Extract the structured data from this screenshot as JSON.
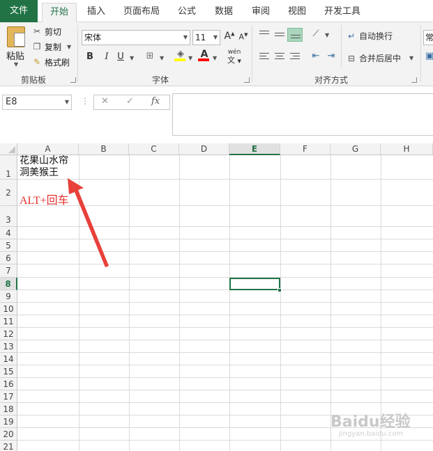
{
  "ribbon_tabs": [
    {
      "label": "文件"
    },
    {
      "label": "开始"
    },
    {
      "label": "插入"
    },
    {
      "label": "页面布局"
    },
    {
      "label": "公式"
    },
    {
      "label": "数据"
    },
    {
      "label": "审阅"
    },
    {
      "label": "视图"
    },
    {
      "label": "开发工具"
    }
  ],
  "active_tab": "开始",
  "clipboard": {
    "paste": "粘贴",
    "cut": "剪切",
    "copy": "复制",
    "format_painter": "格式刷",
    "group_label": "剪贴板"
  },
  "font": {
    "family": "宋体",
    "size": "11",
    "bold": "B",
    "italic": "I",
    "underline": "U",
    "grow": "A",
    "shrink": "A",
    "color_letter": "A",
    "phonetic": "wén",
    "group_label": "字体"
  },
  "alignment": {
    "wrap_text": "自动换行",
    "merge_center": "合并后居中",
    "group_label": "对齐方式",
    "next_group_partial": "常"
  },
  "formula_bar": {
    "name_box": "E8",
    "cancel_icon": "close-icon",
    "enter_icon": "check-icon",
    "fx_label": "fx",
    "value": ""
  },
  "sheet": {
    "columns": [
      "A",
      "B",
      "C",
      "D",
      "E",
      "F",
      "G",
      "H"
    ],
    "rows": [
      "1",
      "2",
      "3",
      "4",
      "5",
      "6",
      "7",
      "8",
      "9",
      "10",
      "11",
      "12",
      "13",
      "14",
      "15",
      "16",
      "17",
      "18",
      "19",
      "20",
      "21"
    ],
    "selected_column": "E",
    "selected_row": "8",
    "cells": {
      "A1_line1": "花果山水帘",
      "A1_line2": "洞美猴王",
      "A2": "ALT+回车"
    }
  },
  "colors": {
    "excel_green": "#217346",
    "annotation_red": "#e2312f",
    "highlight_yellow": "#ffff00",
    "font_red": "#ff0000"
  },
  "watermark": {
    "main": "Baidu经验",
    "sub": "jingyan.baidu.com"
  }
}
